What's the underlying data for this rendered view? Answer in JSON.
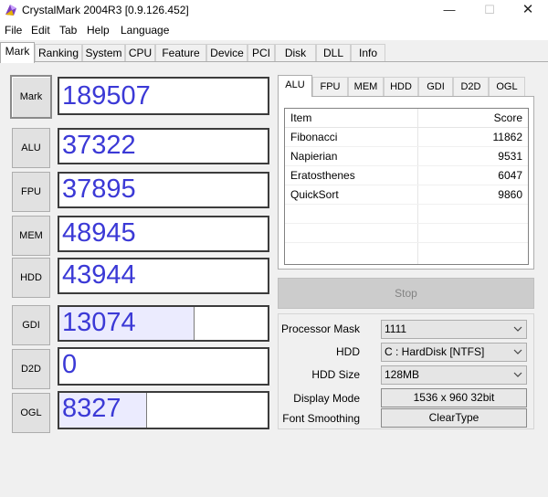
{
  "window": {
    "title": "CrystalMark 2004R3 [0.9.126.452]",
    "min_glyph": "—",
    "max_glyph": "☐",
    "close_glyph": "✕",
    "icon": "crystalmark-logo-icon"
  },
  "menu": [
    {
      "label": "File"
    },
    {
      "label": "Edit"
    },
    {
      "label": "Tab"
    },
    {
      "label": "Help"
    },
    {
      "label": "Language"
    }
  ],
  "tabs": [
    {
      "label": "Mark",
      "active": true
    },
    {
      "label": "Ranking"
    },
    {
      "label": "System"
    },
    {
      "label": "CPU"
    },
    {
      "label": "Feature"
    },
    {
      "label": "Device"
    },
    {
      "label": "PCI"
    },
    {
      "label": "Disk"
    },
    {
      "label": "DLL"
    },
    {
      "label": "Info"
    }
  ],
  "scores": [
    {
      "label": "Mark",
      "value": "189507",
      "fill": 0
    },
    {
      "label": "ALU",
      "value": "37322",
      "fill": 0
    },
    {
      "label": "FPU",
      "value": "37895",
      "fill": 0
    },
    {
      "label": "MEM",
      "value": "48945",
      "fill": 0
    },
    {
      "label": "HDD",
      "value": "43944",
      "fill": 0
    },
    {
      "label": "GDI",
      "value": "13074",
      "fill": 0.65
    },
    {
      "label": "D2D",
      "value": "0",
      "fill": 0
    },
    {
      "label": "OGL",
      "value": "8327",
      "fill": 0.42
    }
  ],
  "subtabs": [
    {
      "label": "ALU",
      "active": true
    },
    {
      "label": "FPU"
    },
    {
      "label": "MEM"
    },
    {
      "label": "HDD"
    },
    {
      "label": "GDI"
    },
    {
      "label": "D2D"
    },
    {
      "label": "OGL"
    }
  ],
  "results": {
    "headers": {
      "item": "Item",
      "score": "Score"
    },
    "rows": [
      {
        "item": "Fibonacci",
        "score": "11862"
      },
      {
        "item": "Napierian",
        "score": "9531"
      },
      {
        "item": "Eratosthenes",
        "score": "6047"
      },
      {
        "item": "QuickSort",
        "score": "9860"
      }
    ]
  },
  "stop_label": "Stop",
  "settings": {
    "processor_mask": {
      "label": "Processor Mask",
      "value": "1111"
    },
    "hdd": {
      "label": "HDD",
      "value": "C : HardDisk [NTFS]"
    },
    "hdd_size": {
      "label": "HDD Size",
      "value": "128MB"
    },
    "display_mode": {
      "label": "Display Mode",
      "value": "1536 x 960 32bit"
    },
    "font_smoothing": {
      "label": "Font Smoothing",
      "value": "ClearType"
    }
  },
  "colors": {
    "score_text": "#3b39d6",
    "bar_fill": "#ebebfe"
  }
}
